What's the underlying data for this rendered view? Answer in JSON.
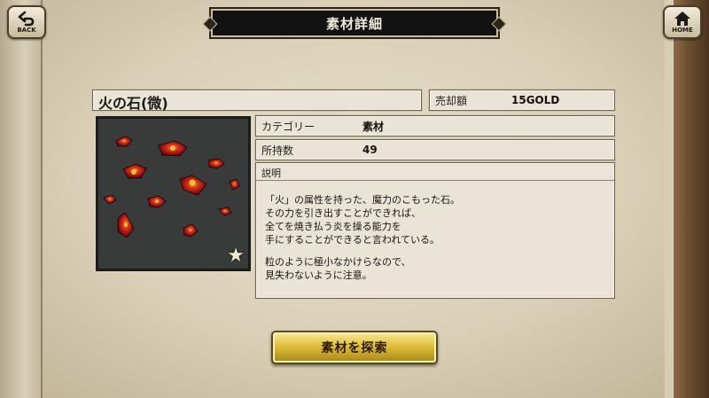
{
  "nav": {
    "back_label": "BACK",
    "home_label": "HOME"
  },
  "header": {
    "title": "素材詳細"
  },
  "item": {
    "name": "火の石(微)",
    "rarity_stars": 1,
    "sell_label": "売却額",
    "sell_value": "15GOLD",
    "category_label": "カテゴリー",
    "category_value": "素材",
    "owned_label": "所持数",
    "owned_value": "49",
    "description_label": "説明",
    "description_lines": [
      "「火」の属性を持った、魔力のこもった石。",
      "その力を引き出すことができれば、",
      "全てを焼き払う炎を操る能力を",
      "手にすることができると言われている。",
      "粒のように極小なかけらなので、",
      "見失わないように注意。"
    ]
  },
  "actions": {
    "explore_label": "素材を探索"
  },
  "colors": {
    "gem_red": "#a8141a",
    "gem_glow": "#ffb020",
    "button_gold": "#e0be3a"
  }
}
